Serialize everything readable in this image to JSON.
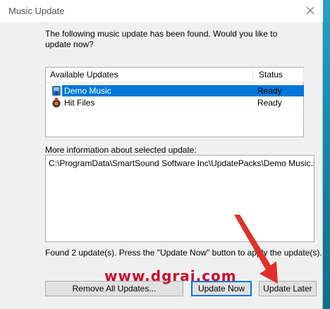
{
  "window": {
    "title": "Music Update"
  },
  "prompt": "The following music update has been found. Would you like to update now?",
  "updates_list": {
    "columns": [
      "Available Updates",
      "Status"
    ],
    "rows": [
      {
        "name": "Demo Music",
        "status": "Ready",
        "selected": true,
        "icon": "music-package-icon"
      },
      {
        "name": "Hit Files",
        "status": "Ready",
        "selected": false,
        "icon": "gift-package-icon"
      }
    ]
  },
  "info": {
    "label": "More information about selected update:",
    "value": "C:\\ProgramData\\SmartSound Software Inc\\UpdatePacks\\Demo Music.ssup"
  },
  "found_text": "Found 2 update(s). Press the \"Update Now\" button to apply the update(s).",
  "buttons": {
    "remove_all": "Remove All Updates...",
    "update_now": "Update Now",
    "update_later": "Update Later"
  },
  "watermark": "www.dgrai.com",
  "colors": {
    "selection": "#0078d7",
    "watermark": "#c8102e",
    "arrow": "#e0302a"
  }
}
